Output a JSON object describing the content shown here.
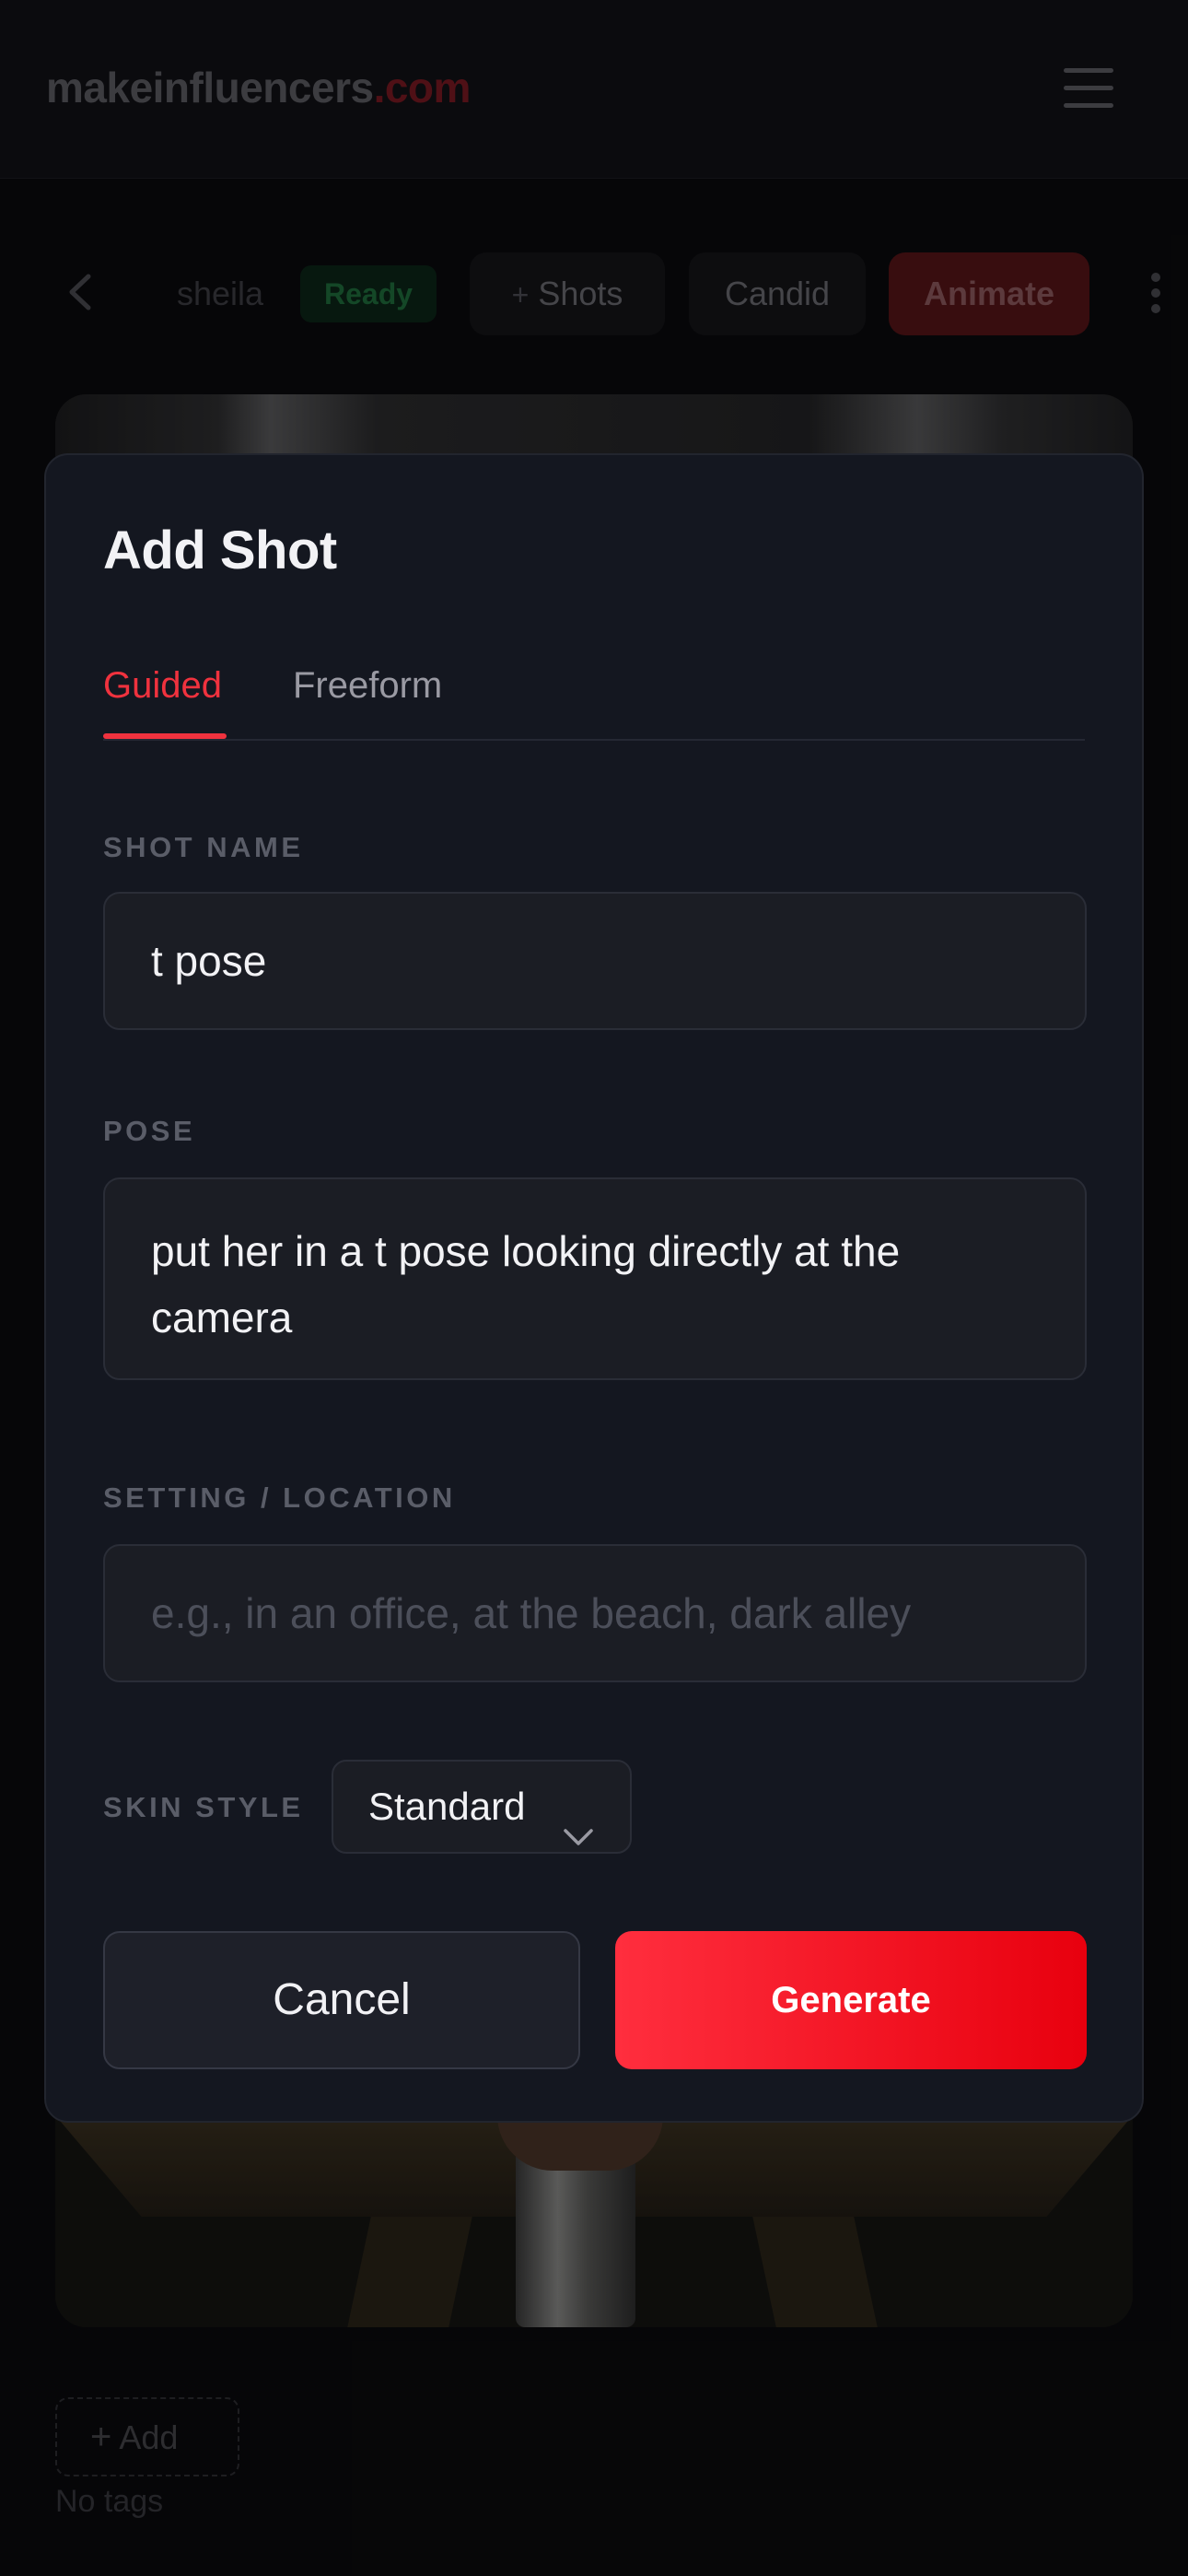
{
  "header": {
    "logo_main": "makeinfluencers",
    "logo_suffix": ".com",
    "menu_icon": "hamburger-menu-icon"
  },
  "toolbar": {
    "back_icon": "chevron-left-icon",
    "name": "sheila",
    "status": "Ready",
    "shots_plus": "+",
    "shots_label": "Shots",
    "candid_label": "Candid",
    "animate_label": "Animate",
    "more_icon": "vertical-ellipsis-icon"
  },
  "tags": {
    "add_plus": "+",
    "add_label": "Add",
    "empty_text": "No tags"
  },
  "modal": {
    "title": "Add Shot",
    "tabs": [
      {
        "label": "Guided",
        "active": true
      },
      {
        "label": "Freeform",
        "active": false
      }
    ],
    "shot_name": {
      "label": "SHOT NAME",
      "value": "t pose"
    },
    "pose": {
      "label": "POSE",
      "value": "put her in a t pose looking directly at the camera"
    },
    "setting": {
      "label": "SETTING / LOCATION",
      "value": "",
      "placeholder": "e.g., in an office, at the beach, dark alley"
    },
    "skin_style": {
      "label": "SKIN STYLE",
      "selected": "Standard"
    },
    "cancel_label": "Cancel",
    "generate_label": "Generate"
  },
  "colors": {
    "accent": "#f0323e",
    "generate_gradient_start": "#ff2e3e",
    "generate_gradient_end": "#e8000e",
    "modal_bg": "#141720",
    "page_bg": "#0a0a0d"
  }
}
